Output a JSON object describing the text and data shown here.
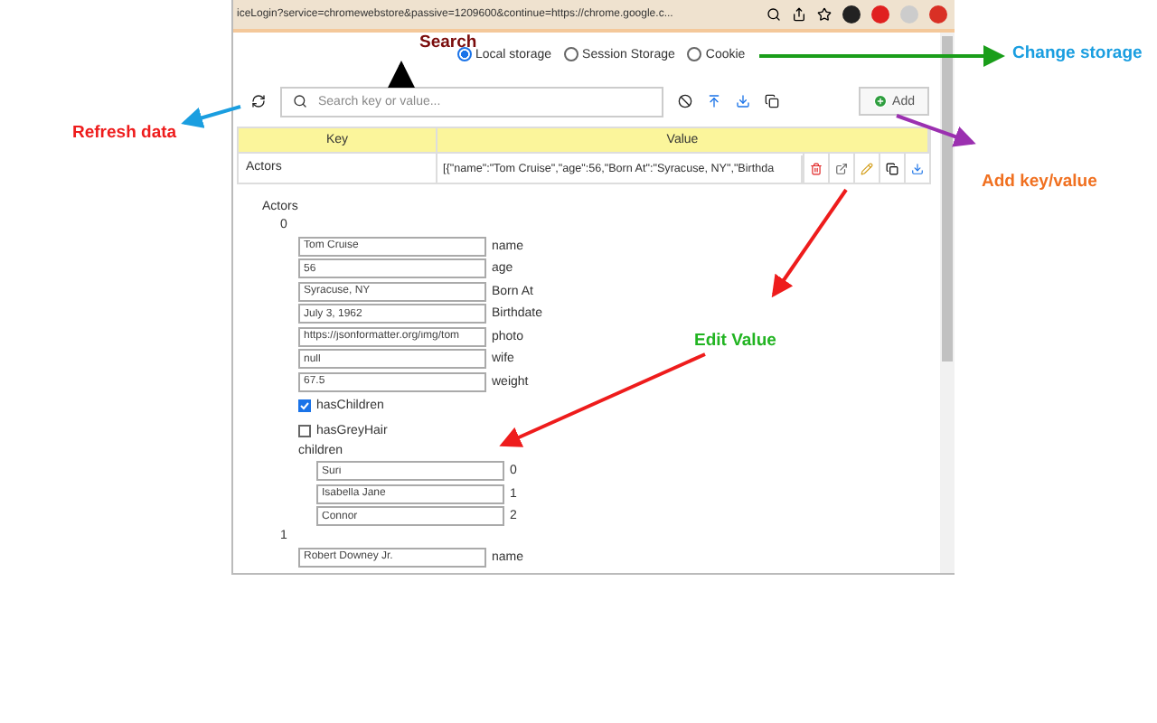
{
  "browser": {
    "url": "iceLogin?service=chromewebstore&passive=1209600&continue=https://chrome.google.c..."
  },
  "annotations": [
    {
      "text": "Search",
      "color": "#7a0c0c"
    },
    {
      "text": "Change storage",
      "color": "#1a9ee0"
    },
    {
      "text": "Refresh data",
      "color": "#ee1c1c"
    },
    {
      "text": "Add key/value",
      "color": "#f07020"
    },
    {
      "text": "Edit Value",
      "color": "#22b422"
    }
  ],
  "storage_options": [
    {
      "label": "Local storage",
      "selected": true
    },
    {
      "label": "Session Storage",
      "selected": false
    },
    {
      "label": "Cookie",
      "selected": false
    }
  ],
  "search": {
    "placeholder": "Search key or value..."
  },
  "add_button": "Add",
  "table": {
    "columns": [
      "Key",
      "Value"
    ],
    "rows": [
      {
        "key": "Actors",
        "value": "[{\"name\":\"Tom Cruise\",\"age\":56,\"Born At\":\"Syracuse, NY\",\"Birthda"
      }
    ]
  },
  "tree": {
    "label": "Actors",
    "children": [
      {
        "kind": "group",
        "label": "0",
        "children": [
          {
            "kind": "field",
            "value": "Tom Cruise",
            "key": "name"
          },
          {
            "kind": "field",
            "value": "56",
            "key": "age"
          },
          {
            "kind": "field",
            "value": "Syracuse, NY",
            "key": "Born At"
          },
          {
            "kind": "field",
            "value": "July 3, 1962",
            "key": "Birthdate"
          },
          {
            "kind": "field",
            "value": "https://jsonformatter.org/img/tom",
            "key": "photo"
          },
          {
            "kind": "field",
            "value": "null",
            "key": "wife"
          },
          {
            "kind": "field",
            "value": "67.5",
            "key": "weight"
          },
          {
            "kind": "checkbox",
            "label": "hasChildren",
            "checked": true
          },
          {
            "kind": "checkbox",
            "label": "hasGreyHair",
            "checked": false
          },
          {
            "kind": "group",
            "label": "children",
            "children": [
              {
                "kind": "field",
                "value": "Suri",
                "key": "0"
              },
              {
                "kind": "field",
                "value": "Isabella Jane",
                "key": "1"
              },
              {
                "kind": "field",
                "value": "Connor",
                "key": "2"
              }
            ]
          }
        ]
      },
      {
        "kind": "group",
        "label": "1",
        "children": [
          {
            "kind": "field",
            "value": "Robert Downey Jr.",
            "key": "name"
          }
        ]
      }
    ]
  }
}
